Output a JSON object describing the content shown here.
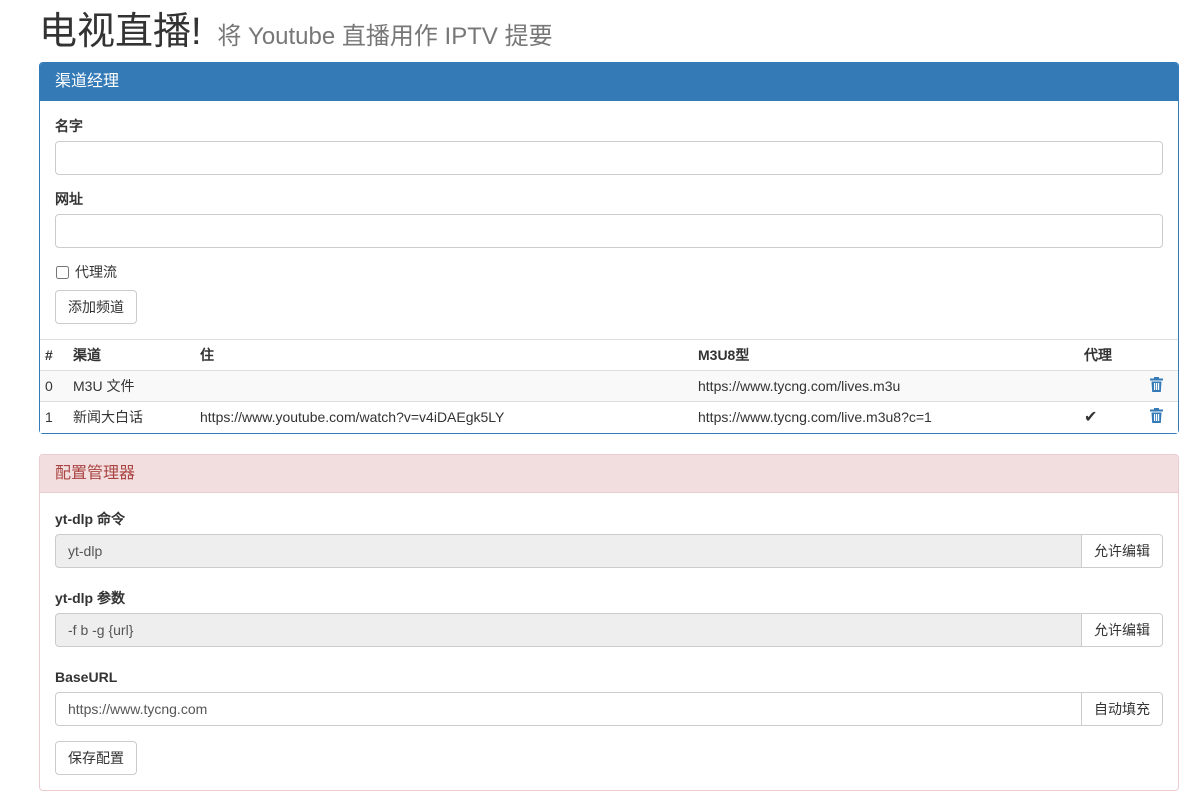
{
  "header": {
    "title": "电视直播!",
    "subtitle": "将 Youtube 直播用作 IPTV 提要"
  },
  "channel_panel": {
    "title": "渠道经理",
    "name_label": "名字",
    "name_value": "",
    "url_label": "网址",
    "url_value": "",
    "proxy_label": "代理流",
    "proxy_checked": false,
    "add_button": "添加频道",
    "table": {
      "headers": [
        "#",
        "渠道",
        "住",
        "M3U8型",
        "代理"
      ],
      "rows": [
        {
          "index": "0",
          "channel": "M3U 文件",
          "live": "",
          "m3u8": "https://www.tycng.com/lives.m3u",
          "proxy": ""
        },
        {
          "index": "1",
          "channel": "新闻大白话",
          "live": "https://www.youtube.com/watch?v=v4iDAEgk5LY",
          "m3u8": "https://www.tycng.com/live.m3u8?c=1",
          "proxy": "✔"
        }
      ]
    }
  },
  "config_panel": {
    "title": "配置管理器",
    "ytdlp_cmd_label": "yt-dlp 命令",
    "ytdlp_cmd_value": "yt-dlp",
    "ytdlp_cmd_button": "允许编辑",
    "ytdlp_args_label": "yt-dlp 参数",
    "ytdlp_args_value": "-f b -g {url}",
    "ytdlp_args_button": "允许编辑",
    "baseurl_label": "BaseURL",
    "baseurl_value": "https://www.tycng.com",
    "baseurl_button": "自动填充",
    "save_button": "保存配置"
  },
  "colors": {
    "primary": "#337ab7",
    "danger_bg": "#f2dede",
    "danger_text": "#a94442"
  }
}
